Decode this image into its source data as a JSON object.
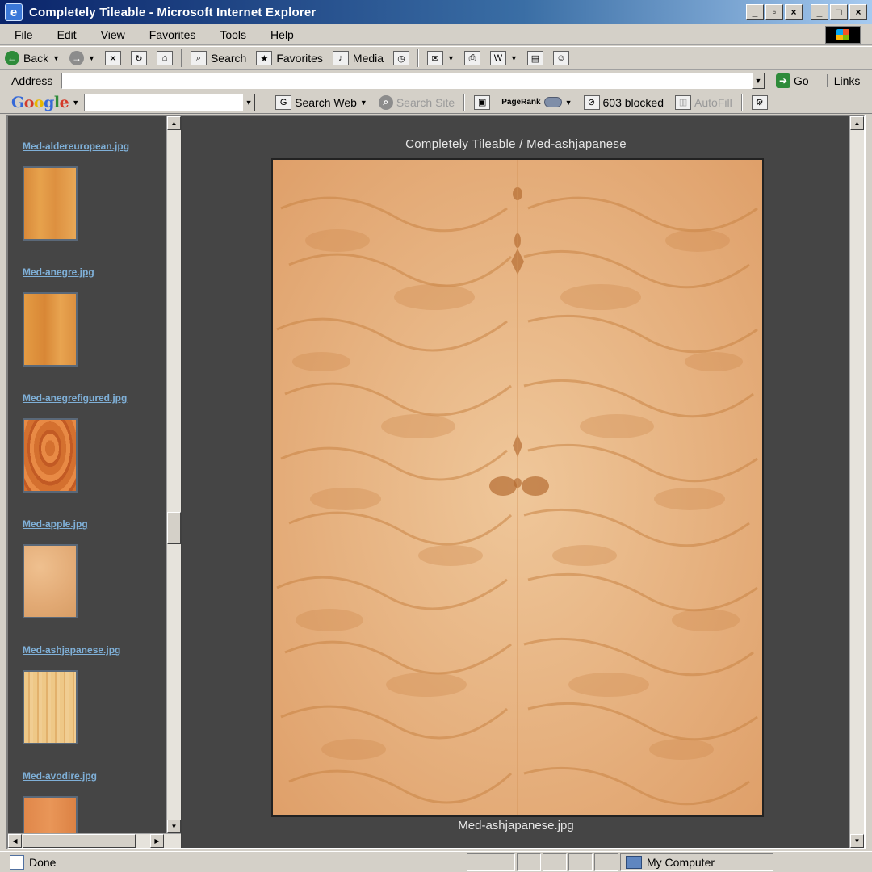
{
  "window": {
    "title": "Completely Tileable - Microsoft Internet Explorer"
  },
  "menu": [
    "File",
    "Edit",
    "View",
    "Favorites",
    "Tools",
    "Help"
  ],
  "toolbar": {
    "back_label": "Back",
    "search_label": "Search",
    "favorites_label": "Favorites",
    "media_label": "Media"
  },
  "address": {
    "label": "Address",
    "value": "",
    "go_label": "Go",
    "links_label": "Links"
  },
  "google": {
    "logo": "Google",
    "search_web_label": "Search Web",
    "search_site_label": "Search Site",
    "pagerank_label": "PageRank",
    "blocked_label": "603 blocked",
    "autofill_label": "AutoFill"
  },
  "thumbnails": [
    {
      "label": "Med-aldereuropean.jpg",
      "color": "#e2973f"
    },
    {
      "label": "Med-anegre.jpg",
      "color": "#e1963c"
    },
    {
      "label": "Med-anegrefigured.jpg",
      "color": "#cf6a2e"
    },
    {
      "label": "Med-apple.jpg",
      "color": "#e2aa75"
    },
    {
      "label": "Med-ashjapanese.jpg",
      "color": "#e8c07d"
    },
    {
      "label": "Med-avodire.jpg",
      "color": "#e0874a"
    }
  ],
  "main": {
    "caption": "Completely Tileable / Med-ashjapanese",
    "filename": "Med-ashjapanese.jpg"
  },
  "status": {
    "text": "Done",
    "zone": "My Computer"
  },
  "colors": {
    "frame_bg": "#454545",
    "link": "#7fb0d8",
    "wood_base": "#e0a56d"
  }
}
